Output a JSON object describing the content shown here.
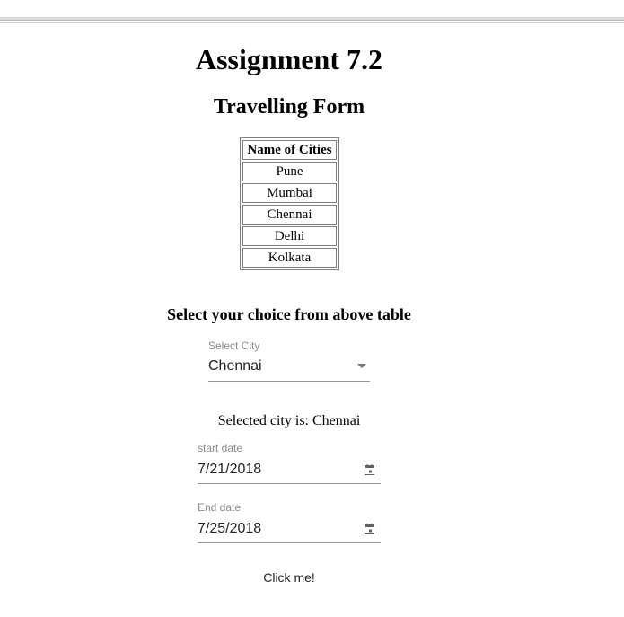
{
  "page": {
    "title": "Assignment 7.2",
    "subtitle": "Travelling Form"
  },
  "cities_table": {
    "header": "Name of Cities",
    "rows": [
      "Pune",
      "Mumbai",
      "Chennai",
      "Delhi",
      "Kolkata"
    ]
  },
  "choice": {
    "heading": "Select your choice from above table",
    "select_label": "Select City",
    "select_value": "Chennai",
    "selected_text": "Selected city is: Chennai"
  },
  "dates": {
    "start_label": "start date",
    "start_value": "7/21/2018",
    "end_label": "End date",
    "end_value": "7/25/2018"
  },
  "button": {
    "label": "Click me!"
  },
  "icons": {
    "dropdown": "chevron-down-icon",
    "calendar": "calendar-icon"
  }
}
